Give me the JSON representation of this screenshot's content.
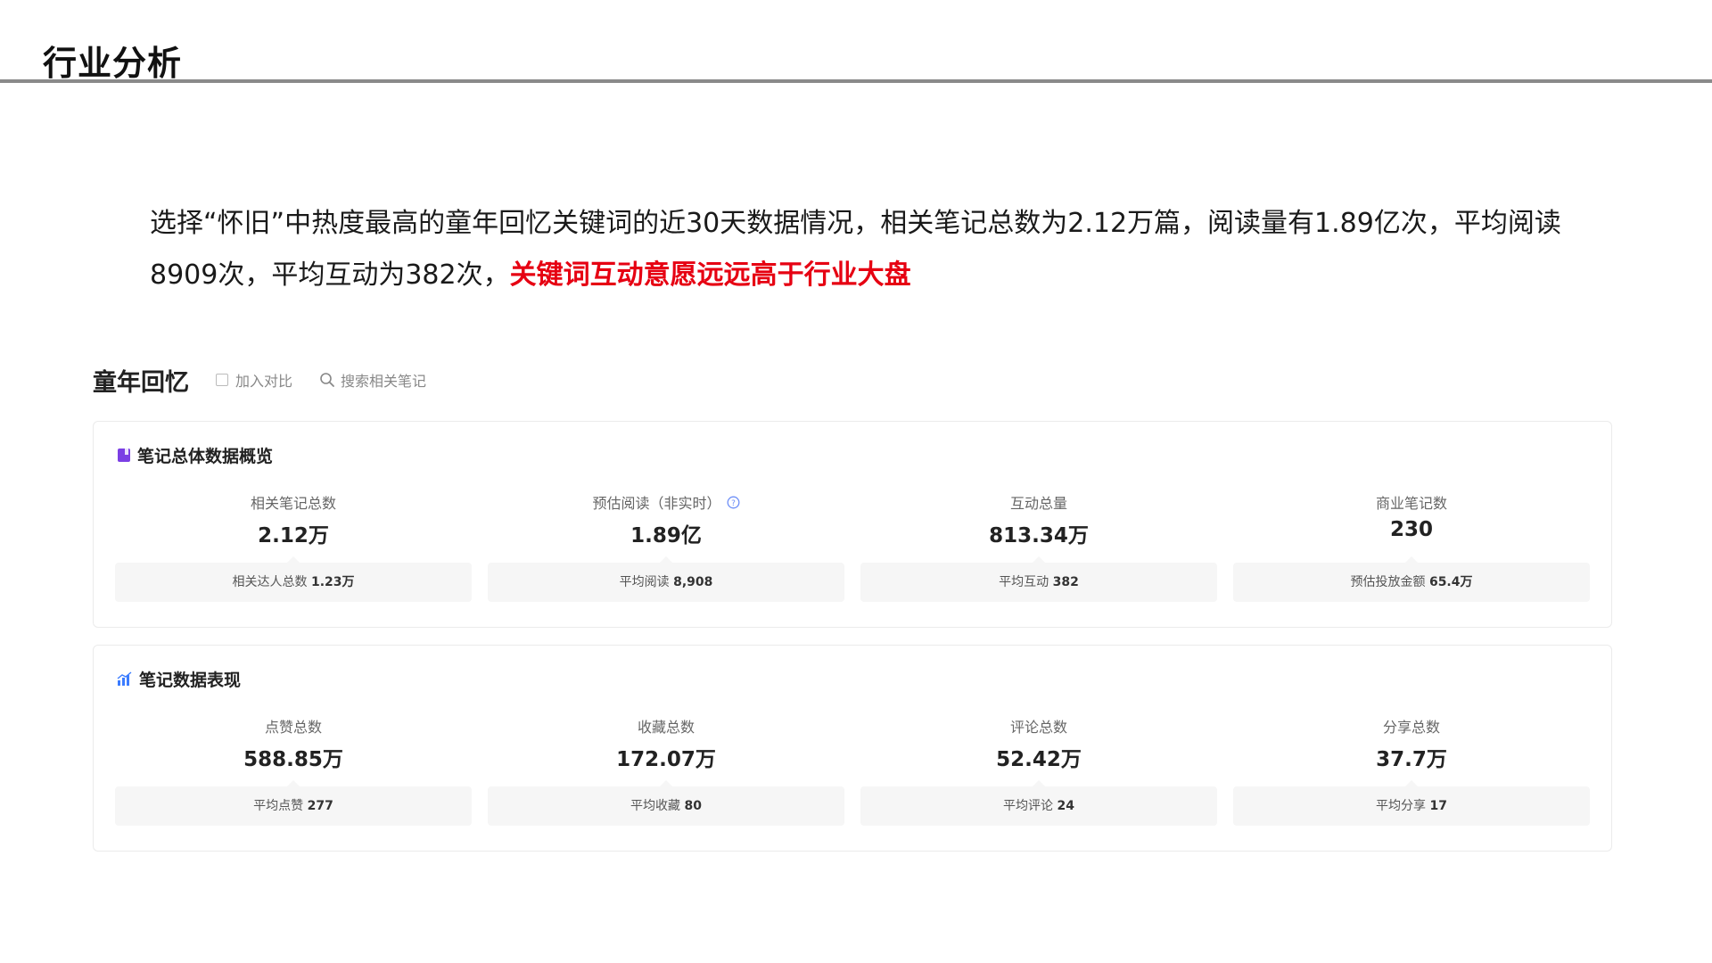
{
  "slide": {
    "title": "行业分析"
  },
  "intro": {
    "text": "选择“怀旧”中热度最高的童年回忆关键词的近30天数据情况，相关笔记总数为2.12万篇，阅读量有1.89亿次，平均阅读8909次，平均互动为382次，",
    "highlight": "关键词互动意愿远远高于行业大盘"
  },
  "keyword": {
    "title": "童年回忆",
    "compare_label": "加入对比",
    "search_label": "搜索相关笔记"
  },
  "overview": {
    "title": "笔记总体数据概览",
    "metrics": [
      {
        "label": "相关笔记总数",
        "value": "2.12万",
        "sub_label": "相关达人总数",
        "sub_value": "1.23万"
      },
      {
        "label": "预估阅读（非实时）",
        "value": "1.89亿",
        "sub_label": "平均阅读",
        "sub_value": "8,908"
      },
      {
        "label": "互动总量",
        "value": "813.34万",
        "sub_label": "平均互动",
        "sub_value": "382"
      },
      {
        "label": "商业笔记数",
        "value": "230",
        "sub_label": "预估投放金额",
        "sub_value": "65.4万"
      }
    ]
  },
  "performance": {
    "title": "笔记数据表现",
    "metrics": [
      {
        "label": "点赞总数",
        "value": "588.85万",
        "sub_label": "平均点赞",
        "sub_value": "277"
      },
      {
        "label": "收藏总数",
        "value": "172.07万",
        "sub_label": "平均收藏",
        "sub_value": "80"
      },
      {
        "label": "评论总数",
        "value": "52.42万",
        "sub_label": "平均评论",
        "sub_value": "24"
      },
      {
        "label": "分享总数",
        "value": "37.7万",
        "sub_label": "平均分享",
        "sub_value": "17"
      }
    ]
  },
  "icons": {
    "overview": "notebook-icon",
    "performance": "bar-chart-icon",
    "help": "question-icon",
    "search": "search-icon",
    "checkbox": "checkbox-icon"
  },
  "colors": {
    "highlight": "#e60012",
    "overview_icon": "#7b3fe4",
    "performance_icon": "#3b7cff",
    "help_icon": "#6e8ff7"
  }
}
